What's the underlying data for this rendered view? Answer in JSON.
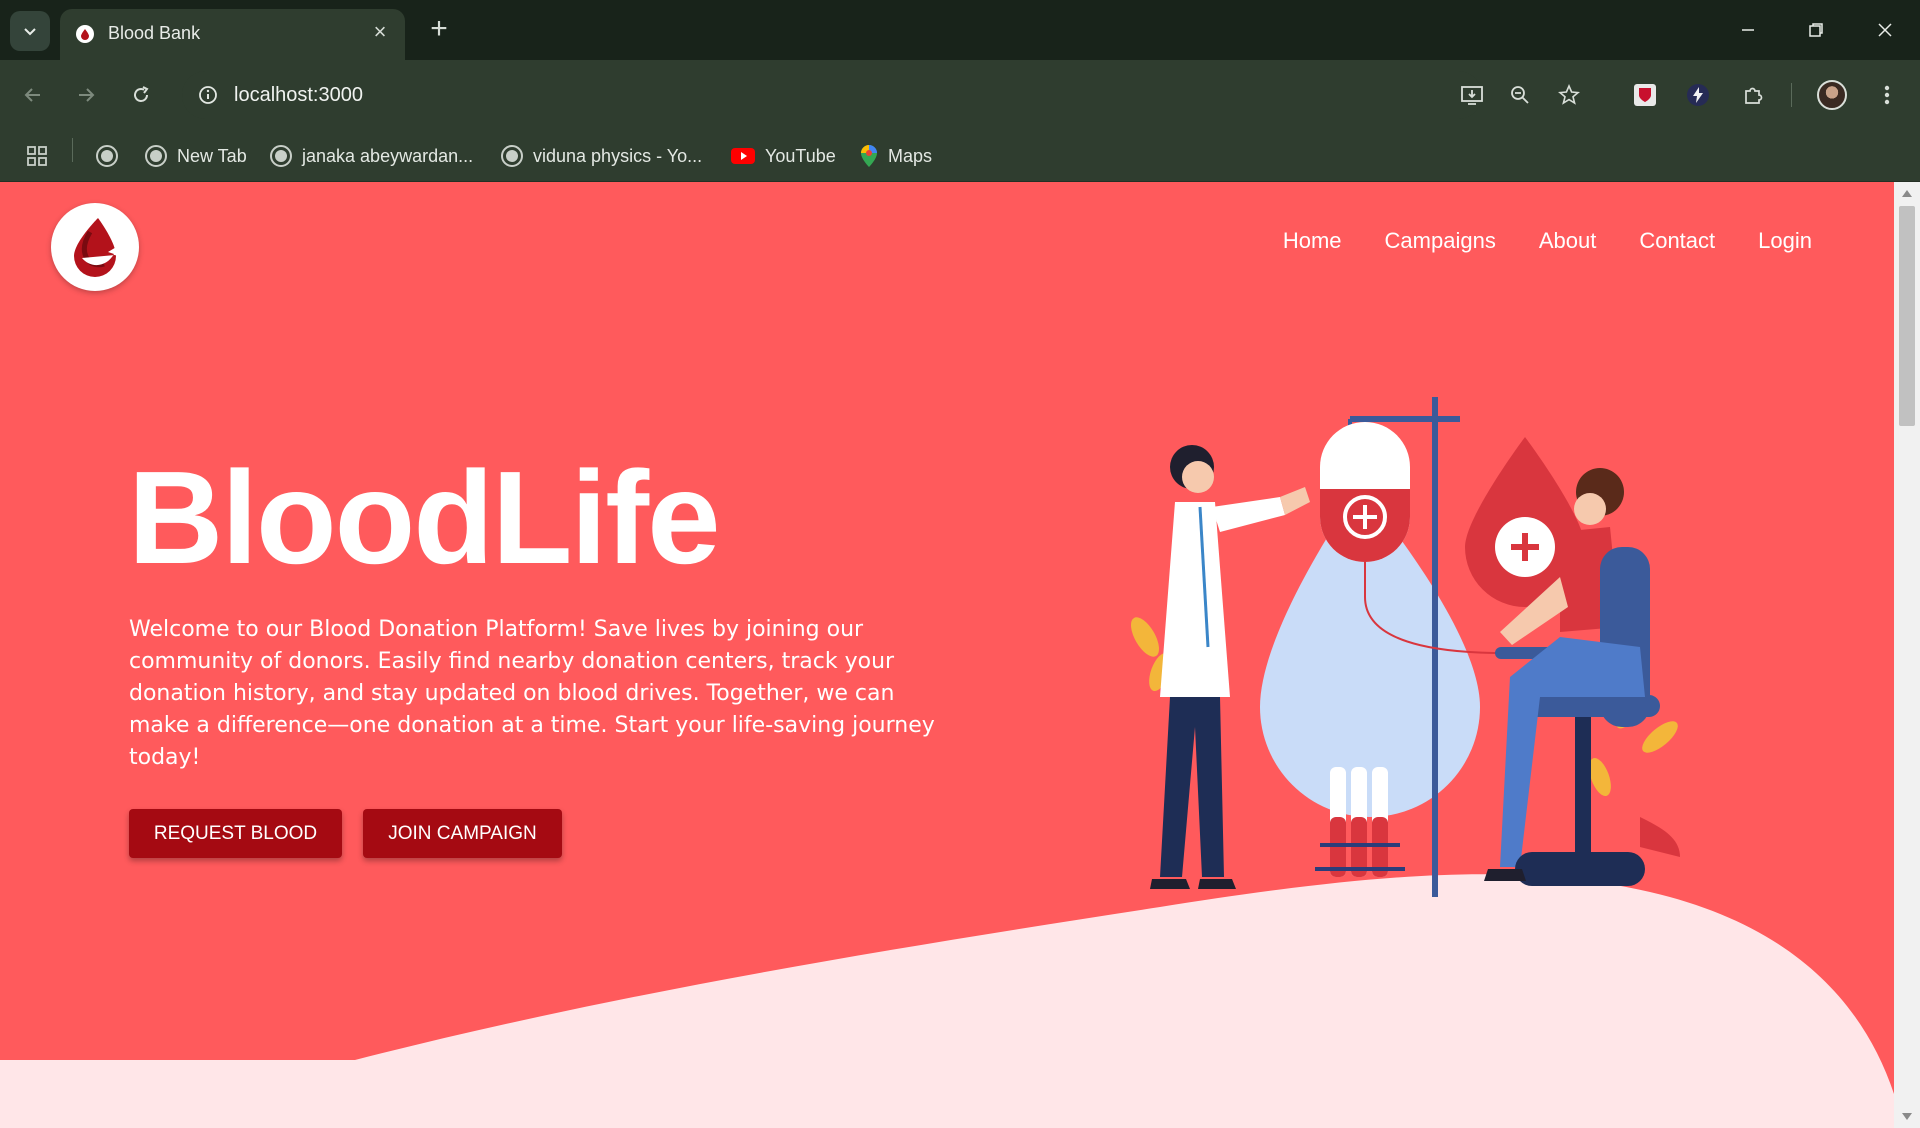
{
  "browser": {
    "tab_title": "Blood Bank",
    "url": "localhost:3000",
    "bookmarks": [
      {
        "label": ""
      },
      {
        "label": "New Tab"
      },
      {
        "label": "janaka abeywardan..."
      },
      {
        "label": "viduna physics - Yo..."
      },
      {
        "label": "YouTube"
      },
      {
        "label": "Maps"
      }
    ]
  },
  "nav": {
    "links": [
      "Home",
      "Campaigns",
      "About",
      "Contact",
      "Login"
    ]
  },
  "hero": {
    "title": "BloodLife",
    "description": "Welcome to our Blood Donation Platform! Save lives by joining our community of donors. Easily find nearby donation centers, track your donation history, and stay updated on blood drives. Together, we can make a difference—one donation at a time. Start your life-saving journey today!",
    "request_button": "REQUEST BLOOD",
    "join_button": "JOIN CAMPAIGN"
  },
  "colors": {
    "hero_bg": "#ff5a5c",
    "wave": "#ffe6e8",
    "button": "#a50a12",
    "chrome_dark": "#18231a",
    "chrome": "#2f3d2f"
  }
}
